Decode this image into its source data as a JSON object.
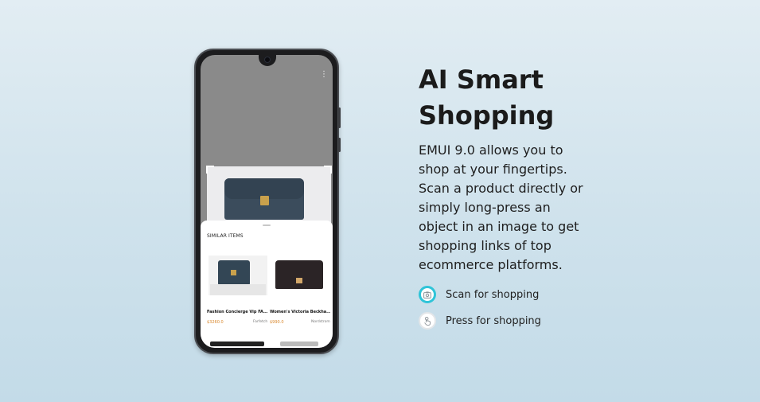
{
  "hero": {
    "title_line1": "AI Smart",
    "title_line2": "Shopping",
    "description": "EMUI 9.0 allows you to shop at your fingertips. Scan a product directly or simply long-press an object in an image to get shopping links of top ecommerce platforms."
  },
  "features": [
    {
      "label": "Scan for shopping",
      "icon": "camera-icon",
      "active": true
    },
    {
      "label": "Press for shopping",
      "icon": "hand-press-icon",
      "active": false
    }
  ],
  "phone_screen": {
    "menu_icon": "⋮",
    "sheet_title": "SIMILAR ITEMS",
    "items": [
      {
        "name": "Fashion Concierge Vip FA...",
        "price": "$3260.0",
        "store": "Farfetch"
      },
      {
        "name": "Women's Victoria Beckha...",
        "price": "$990.0",
        "store": "Nordstrom"
      }
    ]
  },
  "colors": {
    "active_ring": "#2fc4d8",
    "price": "#d9872c",
    "title_text": "#1b1b1b"
  }
}
